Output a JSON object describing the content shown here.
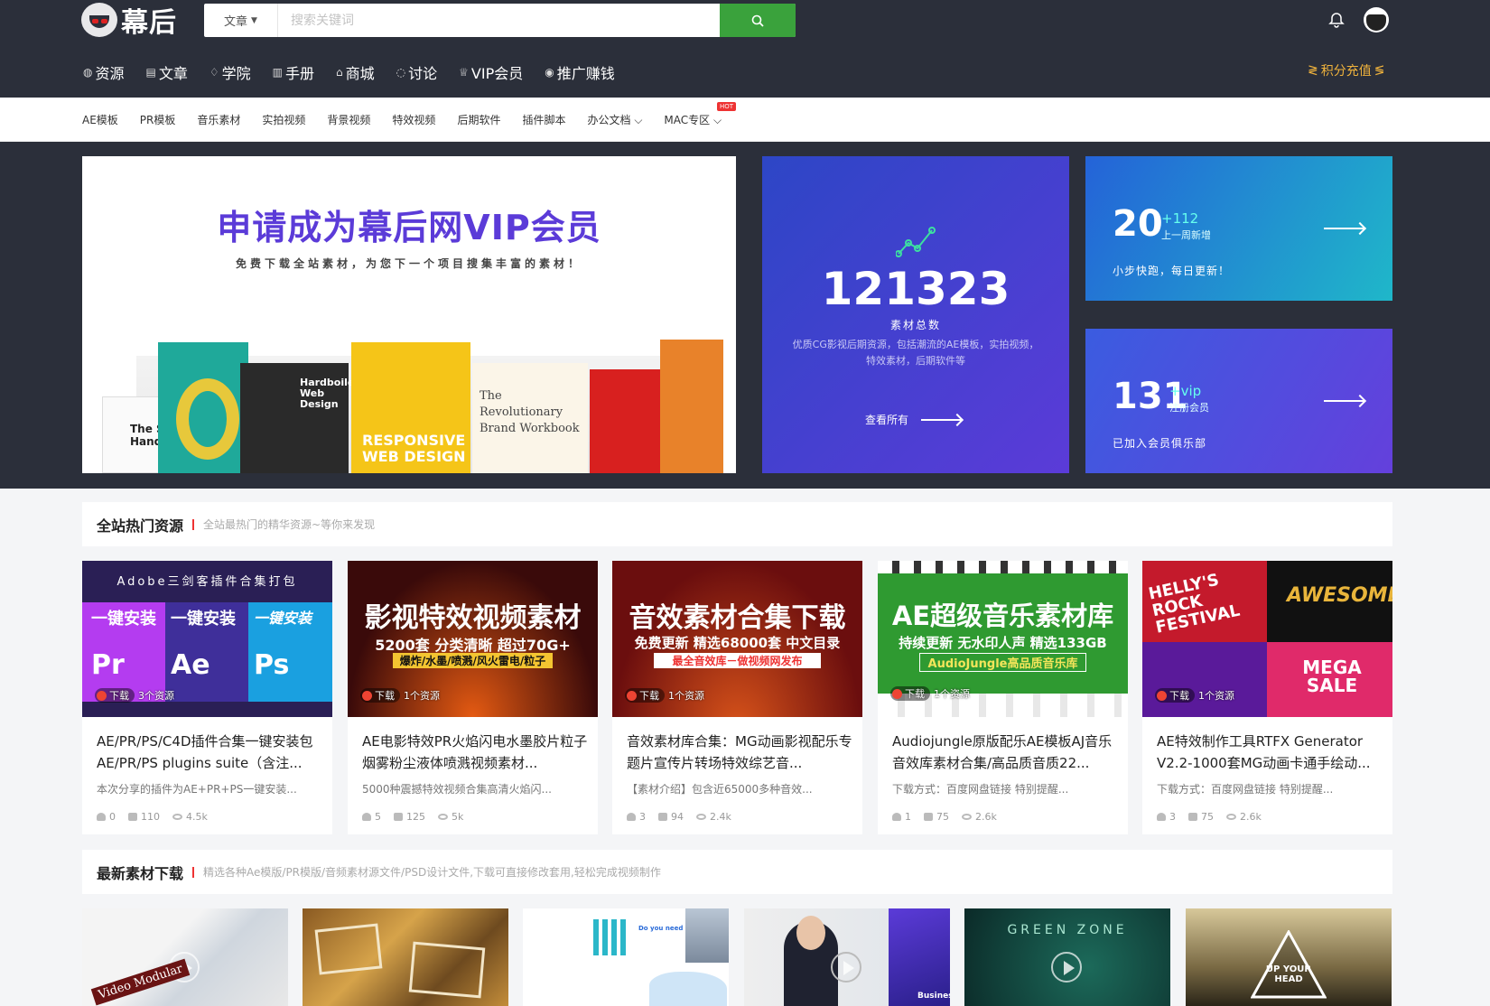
{
  "header": {
    "logo_text": "幕后",
    "search_category": "文章",
    "search_placeholder": "搜索关键词"
  },
  "nav": [
    {
      "label": "资源",
      "icon": "globe-icon"
    },
    {
      "label": "文章",
      "icon": "document-icon"
    },
    {
      "label": "学院",
      "icon": "graduation-cap-icon"
    },
    {
      "label": "手册",
      "icon": "book-icon"
    },
    {
      "label": "商城",
      "icon": "shop-icon"
    },
    {
      "label": "讨论",
      "icon": "chat-icon"
    },
    {
      "label": "VIP会员",
      "icon": "crown-icon"
    },
    {
      "label": "推广赚钱",
      "icon": "money-icon"
    }
  ],
  "topup_label": "积分充值",
  "subnav": [
    {
      "label": "AE模板"
    },
    {
      "label": "PR模板"
    },
    {
      "label": "音乐素材"
    },
    {
      "label": "实拍视频"
    },
    {
      "label": "背景视频"
    },
    {
      "label": "特效视频"
    },
    {
      "label": "后期软件"
    },
    {
      "label": "插件脚本"
    },
    {
      "label": "办公文档"
    },
    {
      "label": "MAC专区",
      "badge": "HOT"
    }
  ],
  "hero": {
    "title": "申请成为幕后网VIP会员",
    "subtitle": "免费下载全站素材，为您下一个项目搜集丰富的素材！",
    "book_titles": [
      "The Sketch Handbook",
      "Hardboiled Web Design",
      "RESPONSIVE WEB DESIGN",
      "The Revolutionary Brand Workbook"
    ]
  },
  "stats": {
    "total": {
      "number": "121323",
      "label": "素材总数",
      "desc": "优质CG影视后期资源，包括潮流的AE模板，实拍视频，特效素材，后期软件等",
      "link": "查看所有"
    },
    "weekly": {
      "number": "20",
      "delta": "+112",
      "delta_label": "上一周新增",
      "desc": "小步快跑，每日更新！"
    },
    "members": {
      "number": "131",
      "delta": "+vip",
      "delta_label": "注册会员",
      "desc": "已加入会员俱乐部"
    }
  },
  "hot_section": {
    "title": "全站热门资源",
    "desc": "全站最热门的精华资源~等你来发现"
  },
  "cards": [
    {
      "thumb_title": "Adobe三剑客插件合集打包",
      "thumb_badges": [
        "一键安装",
        "一键安装",
        "一键安装"
      ],
      "dl_label": "下载",
      "res_count": "3个资源",
      "title": "AE/PR/PS/C4D插件合集一键安装包 AE/PR/PS plugins suite（含注...",
      "excerpt": "本次分享的插件为AE+PR+PS一键安装...",
      "likes": "0",
      "comments": "110",
      "views": "4.5k",
      "color": "#3b2a6e"
    },
    {
      "thumb_title": "影视特效视频素材",
      "thumb_line2": "5200套 分类清晰 超过70G+",
      "thumb_line3": "爆炸/水墨/喷溅/风火雷电/粒子",
      "dl_label": "下载",
      "res_count": "1个资源",
      "title": "AE电影特效PR火焰闪电水墨胶片粒子烟雾粉尘液体喷溅视频素材...",
      "excerpt": "5000种震撼特效视频合集高清火焰闪...",
      "likes": "5",
      "comments": "125",
      "views": "5k",
      "color": "#3a0a0a"
    },
    {
      "thumb_title": "音效素材合集下载",
      "thumb_line2": "免费更新 精选68000套 中文目录",
      "thumb_line3": "最全音效库－做视频网发布",
      "dl_label": "下载",
      "res_count": "1个资源",
      "title": "音效素材库合集：MG动画影视配乐专题片宣传片转场特效综艺音...",
      "excerpt": "【素材介绍】包含近65000多种音效...",
      "likes": "3",
      "comments": "94",
      "views": "2.4k",
      "color": "#8b1414"
    },
    {
      "thumb_title": "AE超级音乐素材库",
      "thumb_line2": "持续更新 无水印人声 精选133GB",
      "thumb_line3": "AudioJungle高品质音乐库",
      "dl_label": "下载",
      "res_count": "1个资源",
      "title": "Audiojungle原版配乐AE模板AJ音乐音效库素材合集/高品质音质22...",
      "excerpt": "下载方式：百度网盘链接 特别提醒...",
      "likes": "1",
      "comments": "75",
      "views": "2.6k",
      "color": "#2e8a2e"
    },
    {
      "thumb_title": "HELLY'S ROCK FESTIVAL",
      "thumb_line2": "AWESOME",
      "thumb_line3": "MEGA SALE",
      "dl_label": "下载",
      "res_count": "1个资源",
      "title": "AE特效制作工具RTFX Generator V2.2-1000套MG动画卡通手绘动...",
      "excerpt": "下载方式：百度网盘链接 特别提醒...",
      "likes": "3",
      "comments": "75",
      "views": "2.6k",
      "color": "#1a1a1a"
    }
  ],
  "new_section": {
    "title": "最新素材下载",
    "desc": "精选各种Ae模版/PR模版/音频素材源文件/PSD设计文件,下载可直接修改套用,轻松完成视频制作"
  },
  "new_cards": [
    {
      "caption": "Video Modular"
    },
    {
      "caption": ""
    },
    {
      "caption": "Do you need"
    },
    {
      "caption": "Business"
    },
    {
      "caption": "GREEN ZONE"
    },
    {
      "caption": "UP YOUR HEAD"
    }
  ],
  "colors": {
    "header_bg": "#2b2f3a",
    "search_btn": "#3aa23c",
    "accent": "#e33333",
    "vip_purple": "#5b3bd8",
    "topup_gold": "#f0b33c"
  }
}
